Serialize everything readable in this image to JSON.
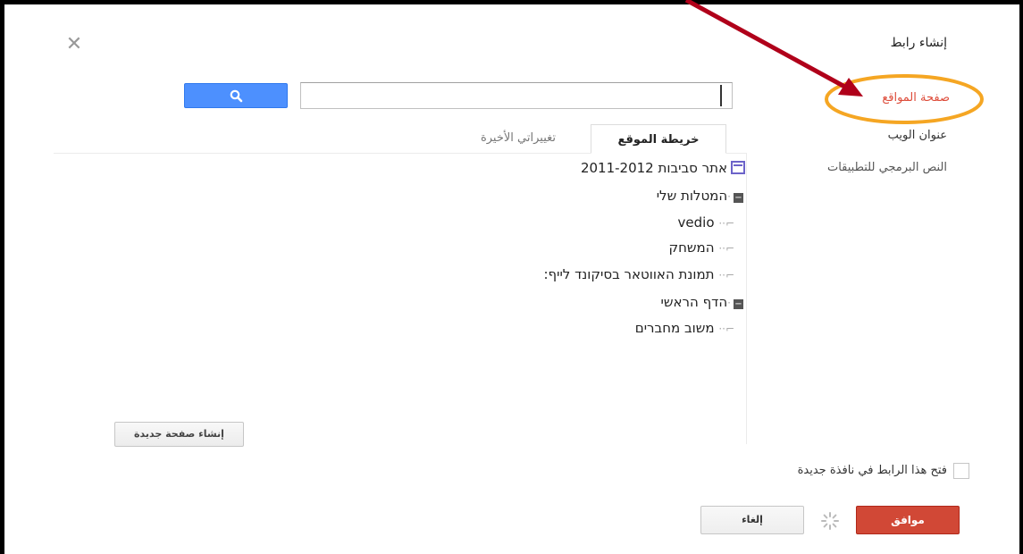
{
  "dialog": {
    "title": "إنشاء رابط",
    "close_glyph": "✕"
  },
  "sidebar": {
    "items": [
      {
        "label": "صفحة المواقع",
        "active": true
      },
      {
        "label": "عنوان الويب",
        "active": false
      },
      {
        "label": "النص البرمجي للتطبيقات",
        "active": false
      }
    ]
  },
  "search": {
    "value": "",
    "button_icon": "search-icon"
  },
  "tabs": [
    {
      "label": "خريطة الموقع",
      "active": true
    },
    {
      "label": "تغييراتي الأخيرة",
      "active": false
    }
  ],
  "tree": {
    "root": "אתר סביבות 2011-2012",
    "items": [
      {
        "label": "המטלות שלי",
        "type": "folder"
      },
      {
        "label": "vedio",
        "type": "child"
      },
      {
        "label": "המשחק",
        "type": "child"
      },
      {
        "label": "תמונת האווטאר בסיקונד לייף:",
        "type": "child"
      },
      {
        "label": "הדף הראשי",
        "type": "folder"
      },
      {
        "label": "משוב מחברים",
        "type": "child"
      }
    ]
  },
  "new_page_button": "إنشاء صفحة جديدة",
  "new_window": {
    "label": "فتح هذا الرابط في نافذة جديدة",
    "checked": false
  },
  "footer": {
    "ok_label": "موافق",
    "cancel_label": "إلغاء"
  },
  "colors": {
    "accent_red": "#dd4b39",
    "ok_red": "#d14836",
    "search_blue": "#4d90fe",
    "annotation_circle": "#f5a623",
    "annotation_arrow": "#b0001a"
  }
}
